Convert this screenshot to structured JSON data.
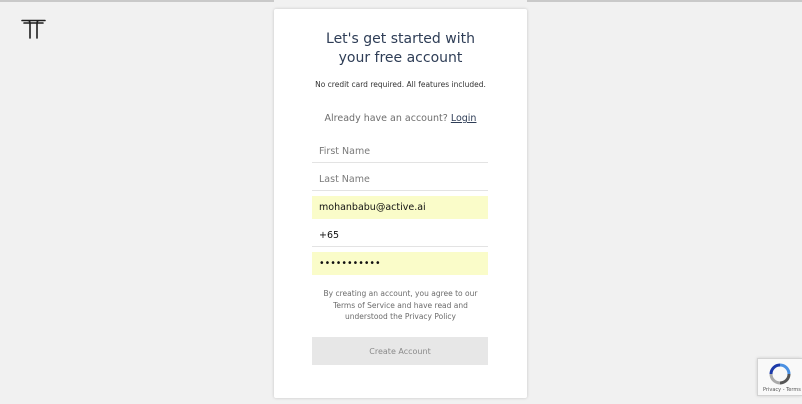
{
  "header": {
    "logo_icon": "brand-logo-icon"
  },
  "signup": {
    "title_line1": "Let's get started with",
    "title_line2": "your free account",
    "subtitle": "No credit card required. All features included.",
    "have_account_text": "Already have an account?",
    "login_link": "Login",
    "first_name": {
      "placeholder": "First Name",
      "value": ""
    },
    "last_name": {
      "placeholder": "Last Name",
      "value": ""
    },
    "email": {
      "value": "mohanbabu@active.ai"
    },
    "phone": {
      "value": "+65"
    },
    "password": {
      "value": "xxxxxxxxxxx"
    },
    "terms_text": "By creating an account, you agree to our Terms of Service and have read and understood the Privacy Policy",
    "create_button": "Create Account"
  },
  "recaptcha": {
    "icon": "recaptcha-icon",
    "text": "Privacy - Terms"
  },
  "colors": {
    "accent": "#2e3d56",
    "autofill_bg": "#fafcc9",
    "page_bg": "#f1f1f1",
    "button_bg": "#e7e7e7"
  }
}
